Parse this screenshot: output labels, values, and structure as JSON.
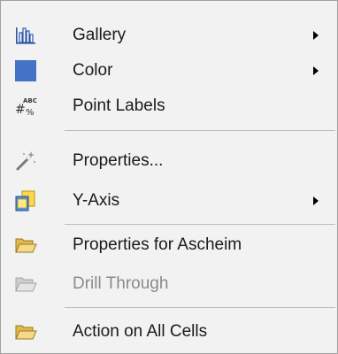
{
  "menu": {
    "items": [
      {
        "label": "Gallery",
        "icon": "gallery-chart-icon",
        "submenu": true
      },
      {
        "label": "Color",
        "icon": "color-swatch-icon",
        "submenu": true,
        "swatch": "#4472c4"
      },
      {
        "label": "Point Labels",
        "icon": "point-labels-icon",
        "submenu": false
      },
      {
        "label": "Properties...",
        "icon": "magic-wand-icon",
        "submenu": false
      },
      {
        "label": "Y-Axis",
        "icon": "y-axis-icon",
        "submenu": true
      },
      {
        "label": "Properties for Ascheim",
        "icon": "folder-open-icon",
        "submenu": false
      },
      {
        "label": "Drill Through",
        "icon": "folder-open-disabled-icon",
        "submenu": false,
        "disabled": true
      },
      {
        "label": "Action on All Cells",
        "icon": "folder-open-icon",
        "submenu": false
      }
    ]
  }
}
